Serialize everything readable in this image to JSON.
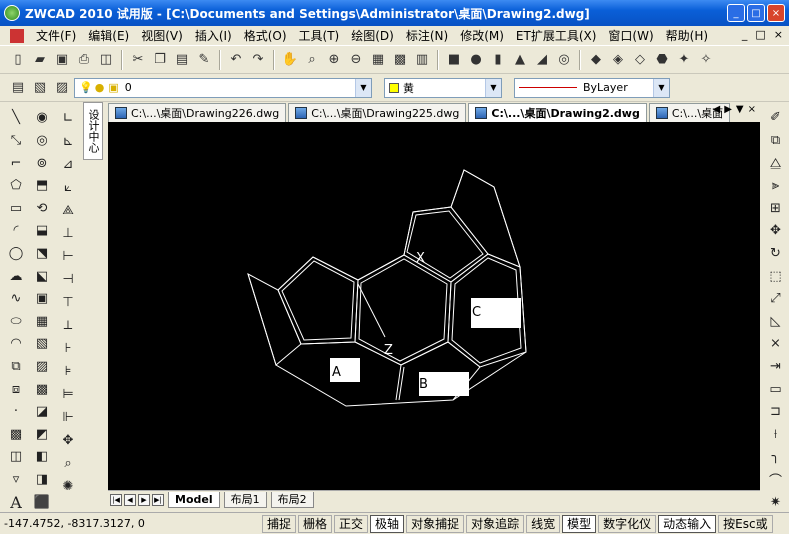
{
  "window": {
    "title": "ZWCAD 2010 试用版 - [C:\\Documents and Settings\\Administrator\\桌面\\Drawing2.dwg]",
    "minimize": "_",
    "maximize": "□",
    "close": "×"
  },
  "menu": {
    "items": [
      "文件(F)",
      "编辑(E)",
      "视图(V)",
      "插入(I)",
      "格式(O)",
      "工具(T)",
      "绘图(D)",
      "标注(N)",
      "修改(M)",
      "ET扩展工具(X)",
      "窗口(W)",
      "帮助(H)"
    ],
    "doc_controls": [
      "_",
      "□",
      "×"
    ]
  },
  "properties": {
    "layer_value": "0",
    "color_value": "黄",
    "color_hex": "#ffff00",
    "linetype_value": "ByLayer"
  },
  "doc_tabs": [
    {
      "label": "C:\\...\\桌面\\Drawing226.dwg",
      "active": false
    },
    {
      "label": "C:\\...\\桌面\\Drawing225.dwg",
      "active": false
    },
    {
      "label": "C:\\...\\桌面\\Drawing2.dwg",
      "active": true
    },
    {
      "label": "C:\\...\\桌面",
      "active": false
    }
  ],
  "tab_nav": [
    "◀",
    "▶",
    "▼",
    "×"
  ],
  "vertical_tab": "设计中心",
  "drawing": {
    "labels": [
      "A",
      "B",
      "C",
      "X",
      "Z"
    ],
    "line_color": "#ffffff",
    "background": "#000000"
  },
  "layout_tabs": [
    "Model",
    "布局1",
    "布局2"
  ],
  "status": {
    "coords": "-147.4752,  -8317.3127,  0",
    "buttons": [
      {
        "label": "捕捉",
        "on": false
      },
      {
        "label": "栅格",
        "on": false
      },
      {
        "label": "正交",
        "on": false
      },
      {
        "label": "极轴",
        "on": true
      },
      {
        "label": "对象捕捉",
        "on": false
      },
      {
        "label": "对象追踪",
        "on": false
      },
      {
        "label": "线宽",
        "on": false
      },
      {
        "label": "模型",
        "on": true
      },
      {
        "label": "数字化仪",
        "on": false
      },
      {
        "label": "动态输入",
        "on": true
      },
      {
        "label": "按Esc或",
        "on": false
      }
    ]
  }
}
